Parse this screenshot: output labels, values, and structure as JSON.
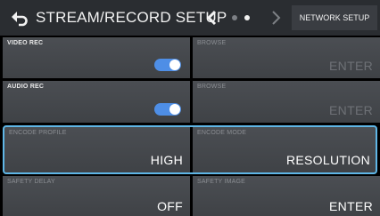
{
  "header": {
    "title": "STREAM/RECORD SETUP",
    "back_icon": "return-arrow-icon",
    "prev_icon": "chevron-left-icon",
    "next_icon": "chevron-right-icon",
    "page_indicator": {
      "total": 2,
      "current": 2
    },
    "network_button_label": "NETWORK SETUP"
  },
  "colors": {
    "header_bg": "#2a2d31",
    "cell_bg": "#45484d",
    "toggle_on": "#4e8ee6",
    "selection": "#5fb6e6",
    "disabled_text": "#6e7176"
  },
  "grid": {
    "video_rec": {
      "label": "VIDEO REC",
      "state": "on"
    },
    "video_browse": {
      "label": "BROWSE",
      "value": "ENTER",
      "enabled": false
    },
    "audio_rec": {
      "label": "AUDIO REC",
      "state": "on"
    },
    "audio_browse": {
      "label": "BROWSE",
      "value": "ENTER",
      "enabled": false
    },
    "encode_profile": {
      "label": "ENCODE PROFILE",
      "value": "HIGH",
      "selected": true
    },
    "encode_mode": {
      "label": "ENCODE MODE",
      "value": "RESOLUTION",
      "selected": true
    },
    "safety_delay": {
      "label": "SAFETY DELAY",
      "value": "OFF"
    },
    "safety_image": {
      "label": "SAFETY IMAGE",
      "value": "ENTER"
    }
  }
}
